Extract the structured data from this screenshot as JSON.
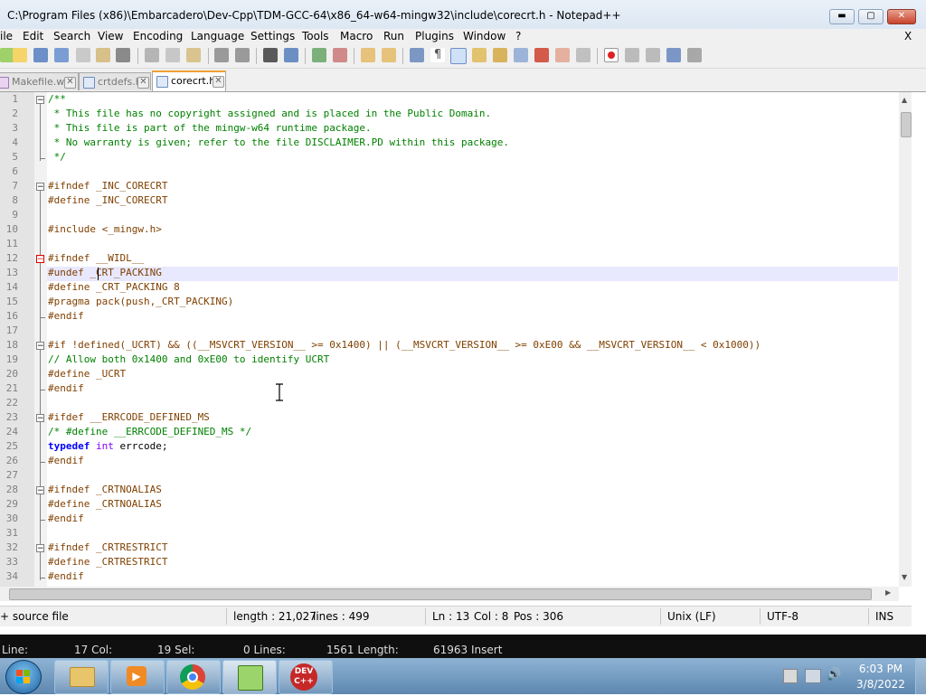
{
  "window": {
    "title": "C:\\Program Files (x86)\\Embarcadero\\Dev-Cpp\\TDM-GCC-64\\x86_64-w64-mingw32\\include\\corecrt.h - Notepad++",
    "minimize": "▬",
    "maximize": "▢",
    "close": "✕"
  },
  "menu": {
    "items": [
      "ile",
      "Edit",
      "Search",
      "View",
      "Encoding",
      "Language",
      "Settings",
      "Tools",
      "Macro",
      "Run",
      "Plugins",
      "Window",
      "?"
    ],
    "close_doc": "X"
  },
  "tabs": [
    {
      "label": "Makefile.win",
      "active": false
    },
    {
      "label": "crtdefs.h",
      "active": false
    },
    {
      "label": "corecrt.h",
      "active": true
    }
  ],
  "editor": {
    "current_line": 13,
    "lines": [
      {
        "n": "1",
        "text": "/**"
      },
      {
        "n": "2",
        "text": " * This file has no copyright assigned and is placed in the Public Domain."
      },
      {
        "n": "3",
        "text": " * This file is part of the mingw-w64 runtime package."
      },
      {
        "n": "4",
        "text": " * No warranty is given; refer to the file DISCLAIMER.PD within this package."
      },
      {
        "n": "5",
        "text": " */"
      },
      {
        "n": "6",
        "text": ""
      },
      {
        "n": "7",
        "text": "#ifndef _INC_CORECRT"
      },
      {
        "n": "8",
        "text": "#define _INC_CORECRT"
      },
      {
        "n": "9",
        "text": ""
      },
      {
        "n": "10",
        "text": "#include <_mingw.h>"
      },
      {
        "n": "11",
        "text": ""
      },
      {
        "n": "12",
        "text": "#ifndef __WIDL__"
      },
      {
        "n": "13",
        "text": "#undef _CRT_PACKING"
      },
      {
        "n": "14",
        "text": "#define _CRT_PACKING 8"
      },
      {
        "n": "15",
        "text": "#pragma pack(push,_CRT_PACKING)"
      },
      {
        "n": "16",
        "text": "#endif"
      },
      {
        "n": "17",
        "text": ""
      },
      {
        "n": "18",
        "text": "#if !defined(_UCRT) && ((__MSVCRT_VERSION__ >= 0x1400) || (__MSVCRT_VERSION__ >= 0xE00 && __MSVCRT_VERSION__ < 0x1000))"
      },
      {
        "n": "19",
        "text": "// Allow both 0x1400 and 0xE00 to identify UCRT"
      },
      {
        "n": "20",
        "text": "#define _UCRT"
      },
      {
        "n": "21",
        "text": "#endif"
      },
      {
        "n": "22",
        "text": ""
      },
      {
        "n": "23",
        "text": "#ifdef __ERRCODE_DEFINED_MS"
      },
      {
        "n": "24",
        "text": "/* #define __ERRCODE_DEFINED_MS */"
      },
      {
        "n": "25",
        "text": "typedef int errcode;"
      },
      {
        "n": "26",
        "text": "#endif"
      },
      {
        "n": "27",
        "text": ""
      },
      {
        "n": "28",
        "text": "#ifndef _CRTNOALIAS"
      },
      {
        "n": "29",
        "text": "#define _CRTNOALIAS"
      },
      {
        "n": "30",
        "text": "#endif"
      },
      {
        "n": "31",
        "text": ""
      },
      {
        "n": "32",
        "text": "#ifndef _CRTRESTRICT"
      },
      {
        "n": "33",
        "text": "#define _CRTRESTRICT"
      },
      {
        "n": "34",
        "text": "#endif"
      }
    ]
  },
  "status": {
    "file_type": "+ source file",
    "length": "length : 21,027",
    "lines": "lines : 499",
    "ln": "Ln : 13",
    "col": "Col : 8",
    "pos": "Pos : 306",
    "eol": "Unix (LF)",
    "encoding": "UTF-8",
    "mode": "INS"
  },
  "devcpp_status": {
    "line": "Line:",
    "col": "17 Col:",
    "sel": "19 Sel:",
    "lines": "0 Lines:",
    "length": "1561 Length:",
    "insert": "61963 Insert"
  },
  "taskbar": {
    "apps": [
      "file-explorer",
      "media-player",
      "chrome",
      "notepad-plus-plus",
      "dev-cpp"
    ],
    "devcpp_label_1": "DEV",
    "devcpp_label_2": "C++",
    "time": "6:03 PM",
    "date": "3/8/2022"
  },
  "colors": {
    "comment": "#008000",
    "preprocessor": "#804000",
    "keyword": "#0000ff",
    "type": "#8000ff",
    "number": "#ff8000",
    "current_line_bg": "#e8e8ff",
    "active_tab_accent": "#f29f32"
  }
}
